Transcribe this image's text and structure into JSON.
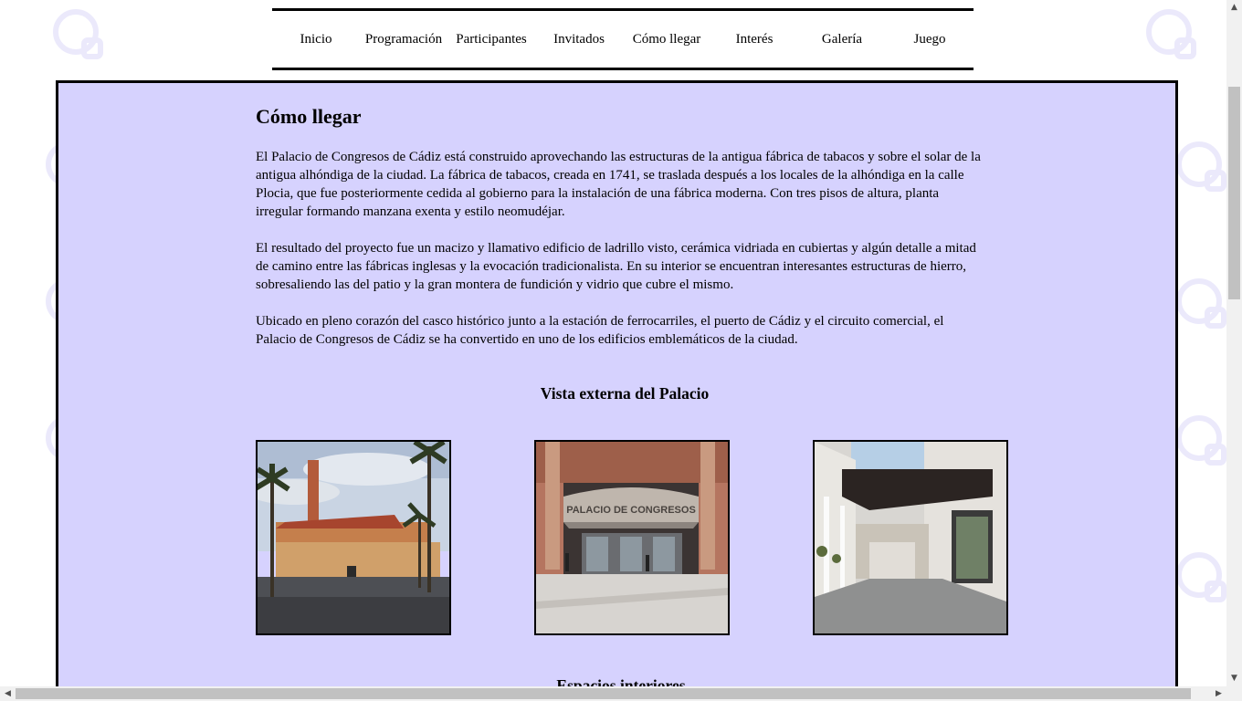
{
  "nav": {
    "items": [
      {
        "label": "Inicio"
      },
      {
        "label": "Programación"
      },
      {
        "label": "Participantes"
      },
      {
        "label": "Invitados"
      },
      {
        "label": "Cómo llegar"
      },
      {
        "label": "Interés"
      },
      {
        "label": "Galería"
      },
      {
        "label": "Juego"
      }
    ]
  },
  "main": {
    "title": "Cómo llegar",
    "paragraphs": [
      "El Palacio de Congresos de Cádiz está construido aprovechando las estructuras de la antigua fábrica de tabacos y sobre el solar de la antigua alhóndiga de la ciudad. La fábrica de tabacos, creada en 1741, se traslada después a los locales de la alhóndiga en la calle Plocia, que fue posteriormente cedida al gobierno para la instalación de una fábrica moderna. Con tres pisos de altura, planta irregular formando manzana exenta y estilo neomudéjar.",
      "El resultado del proyecto fue un macizo y llamativo edificio de ladrillo visto, cerámica vidriada en cubiertas y algún detalle a mitad de camino entre las fábricas inglesas y la evocación tradicionalista. En su interior se encuentran interesantes estructuras de hierro, sobresaliendo las del patio y la gran montera de fundición y vidrio que cubre el mismo.",
      "Ubicado en pleno corazón del casco histórico junto a la estación de ferrocarriles, el puerto de Cádiz y el circuito comercial, el Palacio de Congresos de Cádiz se ha convertido en uno de los edificios emblemáticos de la ciudad."
    ],
    "section_external": "Vista externa del Palacio",
    "section_interior": "Espacios interiores"
  },
  "colors": {
    "panel_bg": "#d6d2fe",
    "border": "#000000",
    "watermark": "#c9c6f5"
  }
}
